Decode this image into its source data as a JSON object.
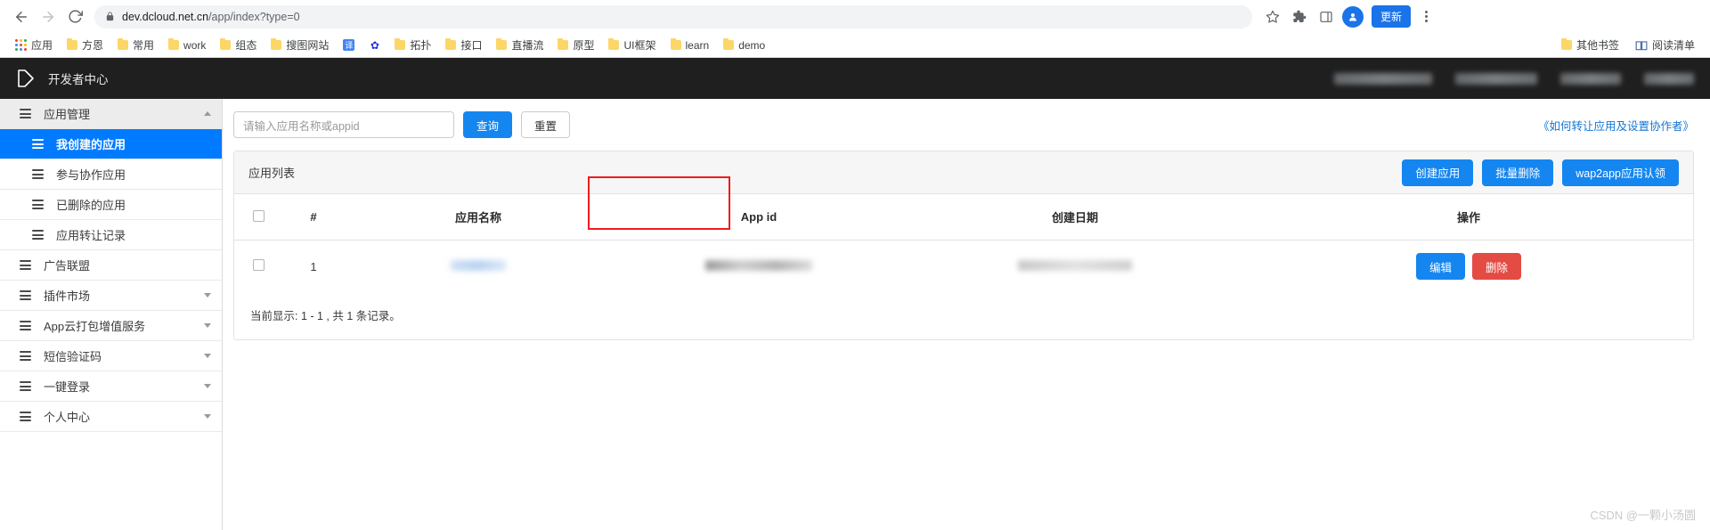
{
  "browser": {
    "back_icon": "back-arrow-icon",
    "forward_icon": "forward-arrow-icon",
    "reload_icon": "reload-icon",
    "lock_icon": "lock-icon",
    "url_host": "dev.dcloud.net.cn",
    "url_path": "/app/index?type=0",
    "star_icon": "bookmark-star-icon",
    "extensions_icon": "extensions-puzzle-icon",
    "sidepanel_icon": "side-panel-icon",
    "profile_initial": "●",
    "update_label": "更新",
    "menu_icon": "three-dot-menu-icon"
  },
  "bookmarks": {
    "apps_label": "应用",
    "items": [
      {
        "label": "方恩",
        "icon": "folder-icon"
      },
      {
        "label": "常用",
        "icon": "folder-icon"
      },
      {
        "label": "work",
        "icon": "folder-icon"
      },
      {
        "label": "组态",
        "icon": "folder-icon"
      },
      {
        "label": "搜图网站",
        "icon": "folder-icon"
      },
      {
        "label": "",
        "icon": "translate-icon",
        "glyph": "译"
      },
      {
        "label": "",
        "icon": "baidu-icon",
        "glyph": "✿"
      },
      {
        "label": "拓扑",
        "icon": "folder-icon"
      },
      {
        "label": "接口",
        "icon": "folder-icon"
      },
      {
        "label": "直播流",
        "icon": "folder-icon"
      },
      {
        "label": "原型",
        "icon": "folder-icon"
      },
      {
        "label": "UI框架",
        "icon": "folder-icon"
      },
      {
        "label": "learn",
        "icon": "folder-icon"
      },
      {
        "label": "demo",
        "icon": "folder-icon"
      }
    ],
    "other_bookmarks": "其他书签",
    "reading_list": "阅读清单"
  },
  "app_header": {
    "logo_icon": "dcloud-logo-icon",
    "title": "开发者中心"
  },
  "sidebar": {
    "items": [
      {
        "label": "应用管理",
        "type": "group",
        "caret": "up"
      },
      {
        "label": "我创建的应用",
        "type": "sub",
        "active": true
      },
      {
        "label": "参与协作应用",
        "type": "sub"
      },
      {
        "label": "已删除的应用",
        "type": "sub"
      },
      {
        "label": "应用转让记录",
        "type": "sub"
      },
      {
        "label": "广告联盟",
        "type": "item"
      },
      {
        "label": "插件市场",
        "type": "item",
        "caret": "down"
      },
      {
        "label": "App云打包增值服务",
        "type": "item",
        "caret": "down"
      },
      {
        "label": "短信验证码",
        "type": "item",
        "caret": "down"
      },
      {
        "label": "一键登录",
        "type": "item",
        "caret": "down"
      },
      {
        "label": "个人中心",
        "type": "item",
        "caret": "down"
      }
    ]
  },
  "toolbar": {
    "search_placeholder": "请输入应用名称或appid",
    "search_value": "",
    "query_label": "查询",
    "reset_label": "重置",
    "help_link": "《如何转让应用及设置协作者》"
  },
  "panel": {
    "title": "应用列表",
    "actions": [
      {
        "label": "创建应用",
        "style": "primary"
      },
      {
        "label": "批量删除",
        "style": "primary"
      },
      {
        "label": "wap2app应用认领",
        "style": "primary"
      }
    ],
    "columns": [
      "",
      "#",
      "应用名称",
      "App id",
      "创建日期",
      "操作"
    ],
    "rows": [
      {
        "index": "1",
        "name": "",
        "appid": "",
        "created": "",
        "edit_label": "编辑",
        "delete_label": "删除"
      }
    ],
    "footer": "当前显示: 1 - 1 , 共 1 条记录。"
  },
  "annotation": {
    "name": "app-id-highlight-box",
    "color": "#f01c1c"
  },
  "watermark": "CSDN @一颗小汤圆",
  "colors": {
    "accent_blue": "#1586f0",
    "sidebar_active": "#007bff",
    "danger_red": "#e44b42",
    "header_dark": "#1f1f1f"
  }
}
